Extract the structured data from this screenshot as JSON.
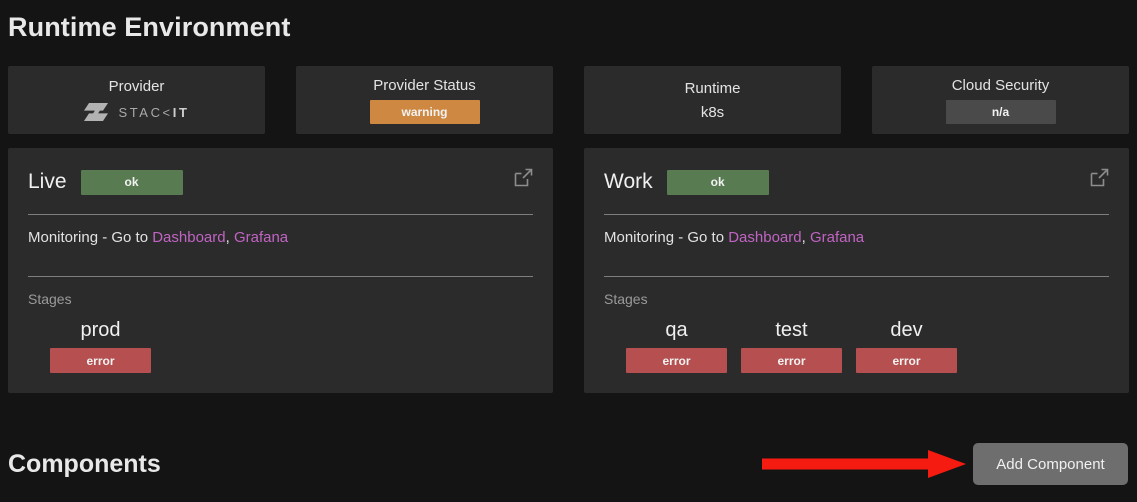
{
  "page": {
    "title": "Runtime Environment",
    "components_title": "Components",
    "add_component_label": "Add Component"
  },
  "colors": {
    "background": "#141414",
    "card": "#2b2b2b",
    "ok": "#587b52",
    "warning": "#ce8842",
    "error": "#b64f4f",
    "na": "#4a4a4a",
    "link": "#c164c4",
    "annotation_arrow": "#f61b10",
    "button": "#6e6e6e"
  },
  "info_cards": [
    {
      "label": "Provider",
      "value": "STACKIT",
      "kind": "logo",
      "logo_name": "stackit-logo"
    },
    {
      "label": "Provider Status",
      "value": "warning",
      "kind": "badge",
      "status": "warning"
    },
    {
      "label": "Runtime",
      "value": "k8s",
      "kind": "text"
    },
    {
      "label": "Cloud Security",
      "value": "n/a",
      "kind": "badge",
      "status": "na"
    }
  ],
  "environments": [
    {
      "name": "Live",
      "status": "ok",
      "status_kind": "ok",
      "monitoring_prefix": "Monitoring - Go to ",
      "monitoring_links": [
        "Dashboard",
        "Grafana"
      ],
      "monitoring_separator": ", ",
      "stages_label": "Stages",
      "stages": [
        {
          "name": "prod",
          "status": "error",
          "status_kind": "error"
        }
      ],
      "external_link_icon": "external-link-icon"
    },
    {
      "name": "Work",
      "status": "ok",
      "status_kind": "ok",
      "monitoring_prefix": "Monitoring - Go to ",
      "monitoring_links": [
        "Dashboard",
        "Grafana"
      ],
      "monitoring_separator": ", ",
      "stages_label": "Stages",
      "stages": [
        {
          "name": "qa",
          "status": "error",
          "status_kind": "error"
        },
        {
          "name": "test",
          "status": "error",
          "status_kind": "error"
        },
        {
          "name": "dev",
          "status": "error",
          "status_kind": "error"
        }
      ],
      "external_link_icon": "external-link-icon"
    }
  ]
}
